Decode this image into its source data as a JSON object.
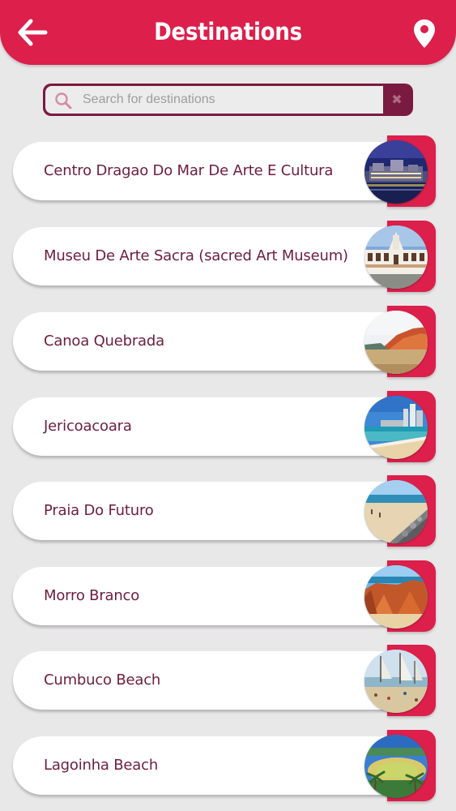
{
  "header": {
    "title": "Destinations",
    "back_icon": "arrow-left-icon",
    "location_icon": "map-pin-icon"
  },
  "search": {
    "placeholder": "Search for destinations",
    "value": "",
    "clear_label": "✖"
  },
  "colors": {
    "primary": "#dc1f4b",
    "dark_accent": "#7b1a40",
    "text": "#6e1d3c",
    "background": "#e9e8e9"
  },
  "destinations": [
    {
      "name": "Centro Dragao Do Mar De Arte E Cultura",
      "thumbnail": "night-building-photo"
    },
    {
      "name": "Museu De Arte Sacra (sacred Art Museum)",
      "thumbnail": "museum-facade-photo"
    },
    {
      "name": "Canoa Quebrada",
      "thumbnail": "red-cliffs-beach-photo"
    },
    {
      "name": "Jericoacoara",
      "thumbnail": "city-beach-photo"
    },
    {
      "name": "Praia Do Futuro",
      "thumbnail": "rocky-beach-photo"
    },
    {
      "name": "Morro Branco",
      "thumbnail": "orange-dunes-photo"
    },
    {
      "name": "Cumbuco Beach",
      "thumbnail": "sailboats-beach-photo"
    },
    {
      "name": "Lagoinha Beach",
      "thumbnail": "palm-lagoon-photo"
    }
  ]
}
